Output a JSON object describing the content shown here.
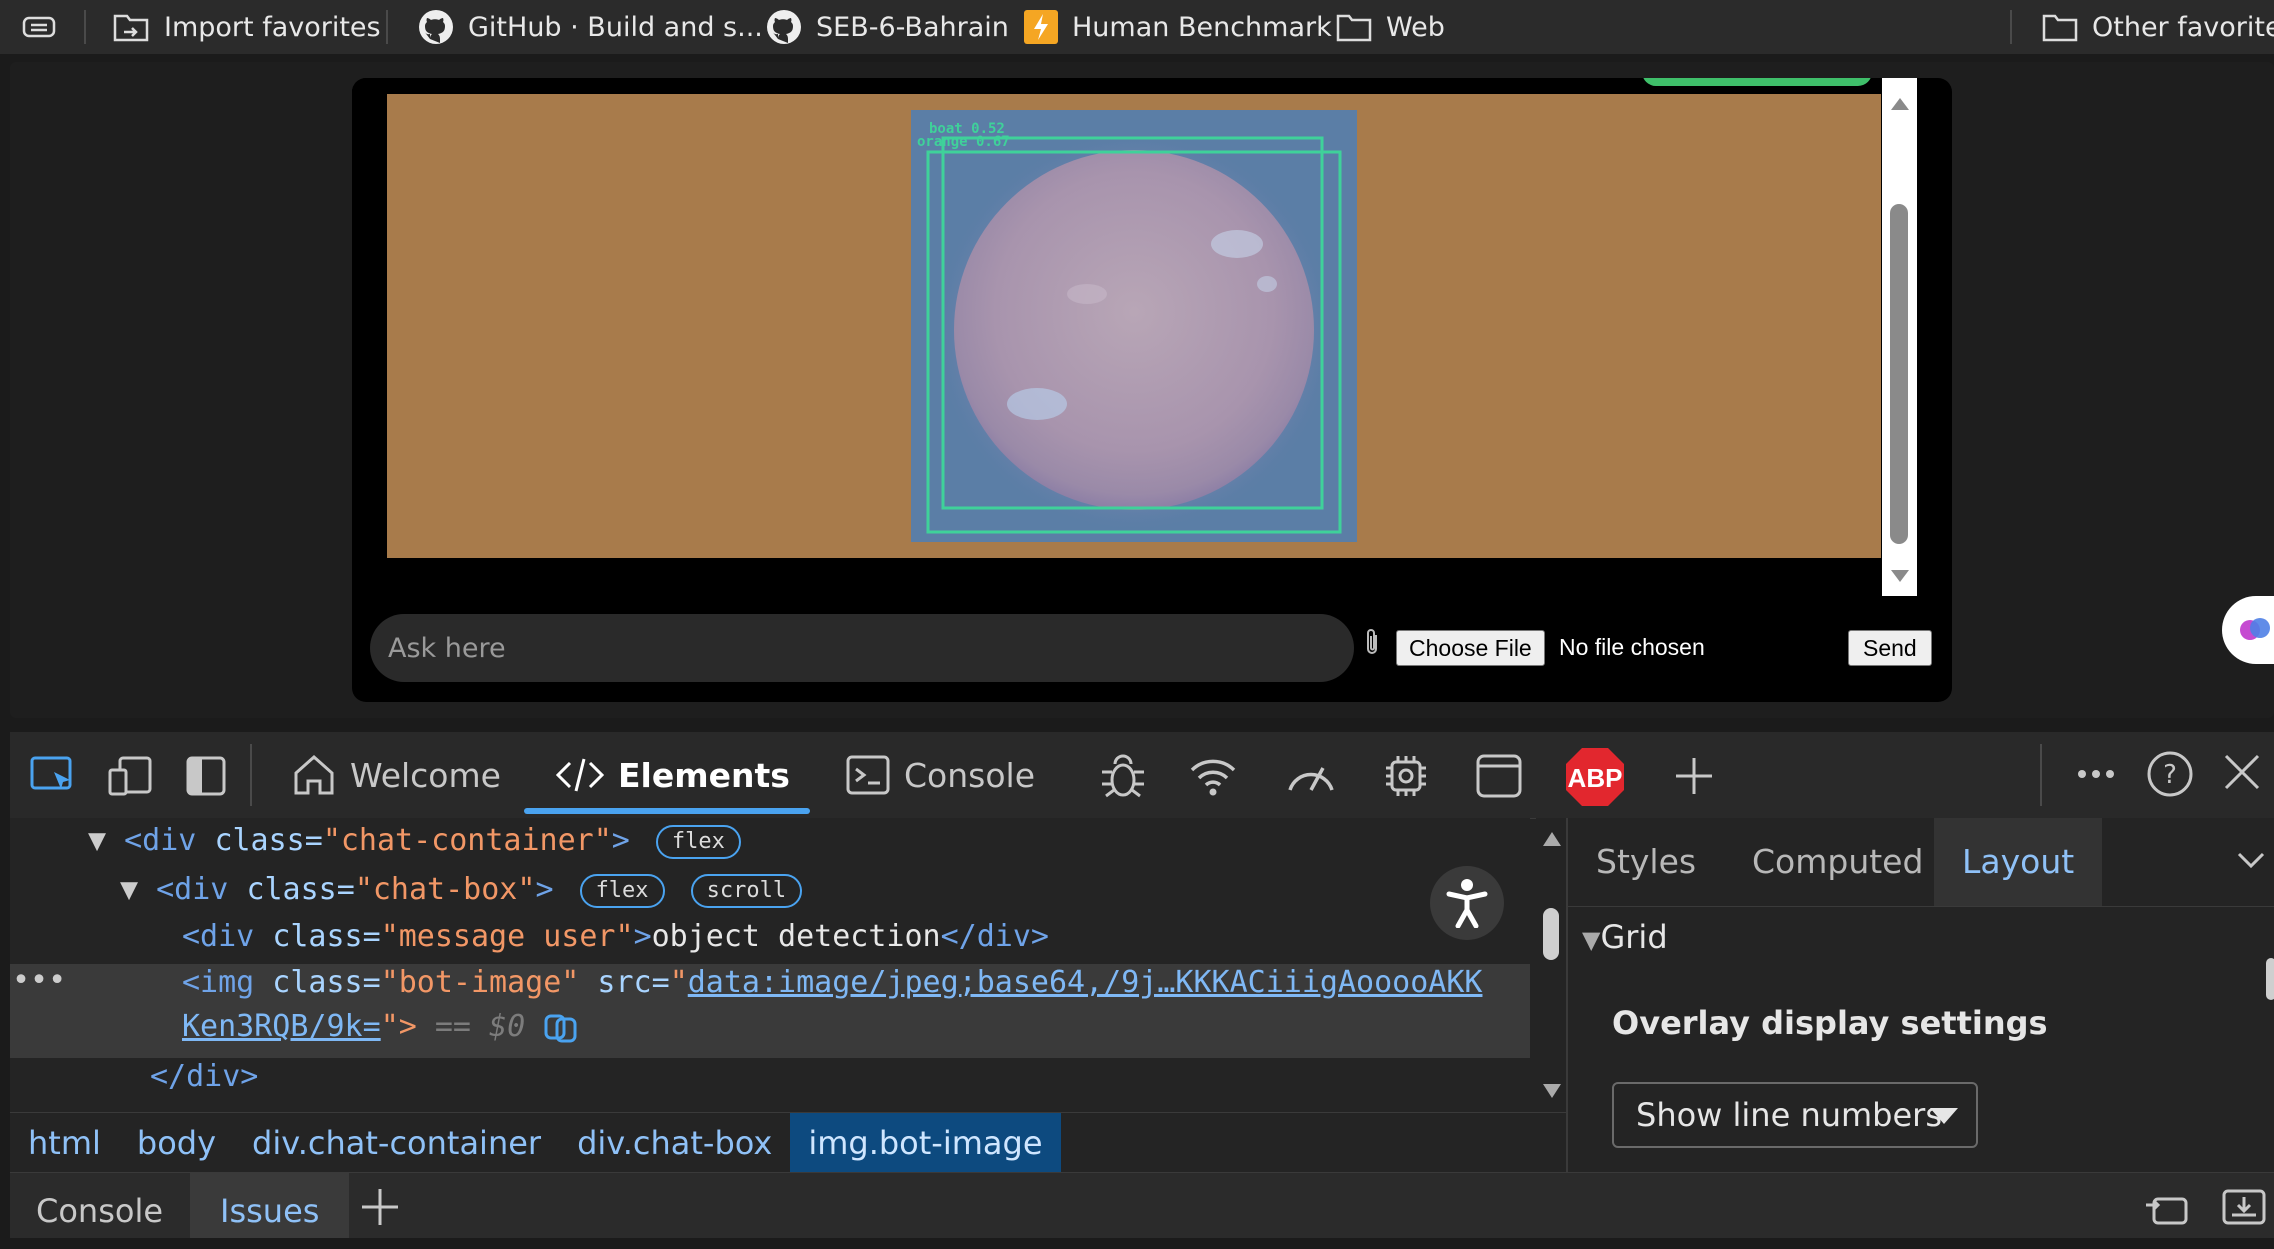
{
  "favorites_bar": {
    "items": [
      {
        "label": "Import favorites",
        "icon": "import-icon"
      },
      {
        "label": "GitHub · Build and s...",
        "icon": "github-icon"
      },
      {
        "label": "SEB-6-Bahrain",
        "icon": "github-icon"
      },
      {
        "label": "Human Benchmark",
        "icon": "lightning-icon"
      },
      {
        "label": "Web",
        "icon": "folder-icon"
      }
    ],
    "other": "Other favorites"
  },
  "chat": {
    "input_placeholder": "Ask here",
    "choose_file": "Choose File",
    "file_status": "No file chosen",
    "send": "Send",
    "detections": [
      "boat 0.52",
      "orange 0.67"
    ]
  },
  "devtools": {
    "tabs": [
      {
        "label": "Welcome",
        "icon": "home-icon"
      },
      {
        "label": "Elements",
        "icon": "code-icon",
        "active": true
      },
      {
        "label": "Console",
        "icon": "console-icon"
      }
    ],
    "elements": {
      "line1": {
        "tag_open": "<div ",
        "attr": "class=",
        "val": "\"chat-container\"",
        "close": ">",
        "badges": [
          "flex"
        ]
      },
      "line2": {
        "tag_open": "<div ",
        "attr": "class=",
        "val": "\"chat-box\"",
        "close": ">",
        "badges": [
          "flex",
          "scroll"
        ]
      },
      "line3": {
        "tag_open": "<div ",
        "attr": "class=",
        "val": "\"message user\"",
        "close": ">",
        "text": "object detection",
        "end": "</div>"
      },
      "line4": {
        "tag_open": "<img",
        "attr1": " class=",
        "val1": "\"bot-image\"",
        "attr2": "  src=",
        "quote": "\"",
        "link1": "data:image/jpeg;base64,/9j…KKKACiiigAooooAKK"
      },
      "line5": {
        "link2": "Ken3RQB/9k=",
        "close": "\">",
        "eq": " == $0"
      },
      "line6": {
        "end": "</div>"
      }
    },
    "breadcrumbs": [
      "html",
      "body",
      "div.chat-container",
      "div.chat-box",
      "img.bot-image"
    ],
    "right_panel": {
      "tabs": [
        "Styles",
        "Computed",
        "Layout"
      ],
      "active_tab": "Layout",
      "section": "Grid",
      "subheading": "Overlay display settings",
      "select_value": "Show line numbers"
    },
    "drawer_tabs": [
      "Console",
      "Issues"
    ],
    "active_drawer": "Issues",
    "accent": "#4aa3f0"
  }
}
